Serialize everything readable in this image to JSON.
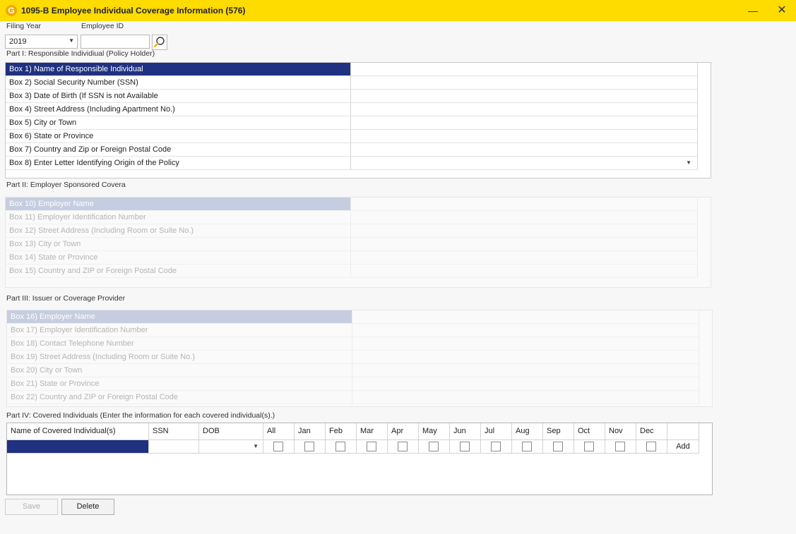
{
  "window": {
    "logo": "G",
    "title": "1095-B Employee Individual Coverage Information (576)"
  },
  "filter": {
    "filing_year_label": "Filing Year",
    "filing_year_value": "2019",
    "employee_id_label": "Employee ID",
    "employee_id_value": ""
  },
  "part1": {
    "title": "Part I: Responsible Individiual (Policy Holder)",
    "rows": [
      {
        "label": "Box 1) Name of Responsible Individual",
        "value": ""
      },
      {
        "label": "Box 2) Social Security Number (SSN)",
        "value": ""
      },
      {
        "label": "Box 3) Date of Birth (If SSN is not Available",
        "value": ""
      },
      {
        "label": "Box 4) Street Address (Including Apartment No.)",
        "value": ""
      },
      {
        "label": "Box 5) City or Town",
        "value": ""
      },
      {
        "label": "Box 6) State or Province",
        "value": ""
      },
      {
        "label": "Box 7) Country and Zip or Foreign Postal Code",
        "value": ""
      },
      {
        "label": "Box 8) Enter Letter Identifying Origin of the Policy",
        "value": ""
      }
    ]
  },
  "part2": {
    "title": "Part II: Employer Sponsored Covera",
    "rows": [
      {
        "label": "Box 10) Employer Name",
        "value": ""
      },
      {
        "label": "Box 11) Employer Identification Number",
        "value": ""
      },
      {
        "label": "Box 12) Street Address (Including Room or Suite No.)",
        "value": ""
      },
      {
        "label": "Box 13) City or Town",
        "value": ""
      },
      {
        "label": "Box 14) State or Province",
        "value": ""
      },
      {
        "label": "Box 15) Country and ZIP or Foreign Postal Code",
        "value": ""
      }
    ]
  },
  "part3": {
    "title": "Part III: Issuer or Coverage Provider",
    "rows": [
      {
        "label": "Box 16) Employer Name",
        "value": ""
      },
      {
        "label": "Box 17) Employer Identification Number",
        "value": ""
      },
      {
        "label": "Box 18) Contact Telephone Number",
        "value": ""
      },
      {
        "label": "Box 19) Street Address (Including Room or Suite No.)",
        "value": ""
      },
      {
        "label": "Box 20) City or Town",
        "value": ""
      },
      {
        "label": "Box 21) State or Province",
        "value": ""
      },
      {
        "label": "Box 22) Country and ZIP or Foreign Postal Code",
        "value": ""
      }
    ]
  },
  "part4": {
    "title": "Part IV: Covered Individuals (Enter the information for each covered individual(s).)",
    "columns": [
      "Name of Covered Individual(s)",
      "SSN",
      "DOB",
      "All",
      "Jan",
      "Feb",
      "Mar",
      "Apr",
      "May",
      "Jun",
      "Jul",
      "Aug",
      "Sep",
      "Oct",
      "Nov",
      "Dec",
      ""
    ],
    "add_label": "Add"
  },
  "buttons": {
    "save": "Save",
    "delete": "Delete"
  },
  "colors": {
    "titlebar": "#ffdc00",
    "selection": "#1f3180",
    "selection_disabled": "#c7cde0"
  }
}
